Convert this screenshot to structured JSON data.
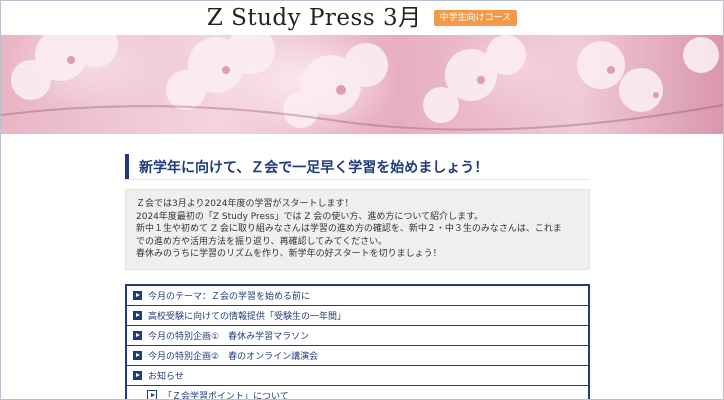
{
  "header": {
    "title": "Z Study Press 3月",
    "badge": "中学生向けコース"
  },
  "main": {
    "heading": "新学年に向けて、Ｚ会で一足早く学習を始めましょう！",
    "intro_lines": [
      "Ｚ会では3月より2024年度の学習がスタートします！",
      "2024年度最初の「Z Study Press」では Z 会の使い方、進め方について紹介します。",
      "新中１生や初めて Z 会に取り組みなさんは学習の進め方の確認を、新中２・中３生のみなさんは、これま",
      "での進め方や活用方法を振り返り、再確認してみてください。",
      "春休みのうちに学習のリズムを作り、新学年の好スタートを切りましょう！"
    ],
    "menu": [
      "今月のテーマ：Ｚ会の学習を始める前に",
      "高校受験に向けての情報提供「受験生の一年間」",
      "今月の特別企画①　春休み学習マラソン",
      "今月の特別企画②　春のオンライン講演会",
      "お知らせ"
    ],
    "submenu": [
      "「Ｚ会学習ポイント」について"
    ]
  },
  "colors": {
    "accent": "#1e3c78",
    "badge": "#f2994a",
    "intro_bg": "#efefef"
  }
}
